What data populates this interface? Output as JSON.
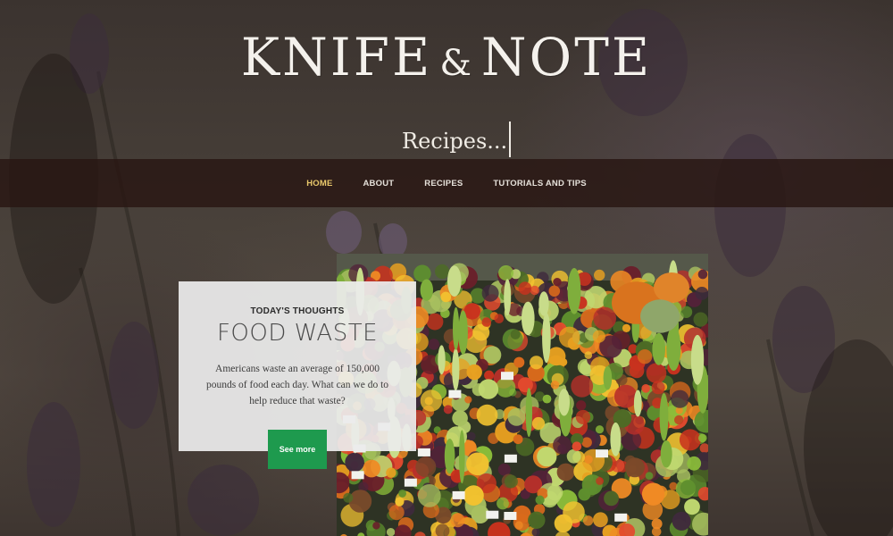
{
  "site": {
    "title_left": "KNIFE",
    "title_amp": "&",
    "title_right": "NOTE",
    "tagline": "Recipes..."
  },
  "nav": {
    "items": [
      {
        "label": "HOME",
        "active": true
      },
      {
        "label": "ABOUT",
        "active": false
      },
      {
        "label": "RECIPES",
        "active": false
      },
      {
        "label": "TUTORIALS AND TIPS",
        "active": false
      }
    ]
  },
  "feature": {
    "kicker": "TODAY'S THOUGHTS",
    "title": "FOOD WASTE",
    "text": "Americans waste an average of 150,000 pounds of food each day. What can we do to help reduce that waste?",
    "button_label": "See more"
  },
  "colors": {
    "nav_active": "#e9c86b",
    "button_green": "#1e9a4e",
    "navbar_bg": "#281612"
  },
  "icons": {
    "background": "lavender-background-image",
    "photo": "vegetable-market-photo"
  }
}
